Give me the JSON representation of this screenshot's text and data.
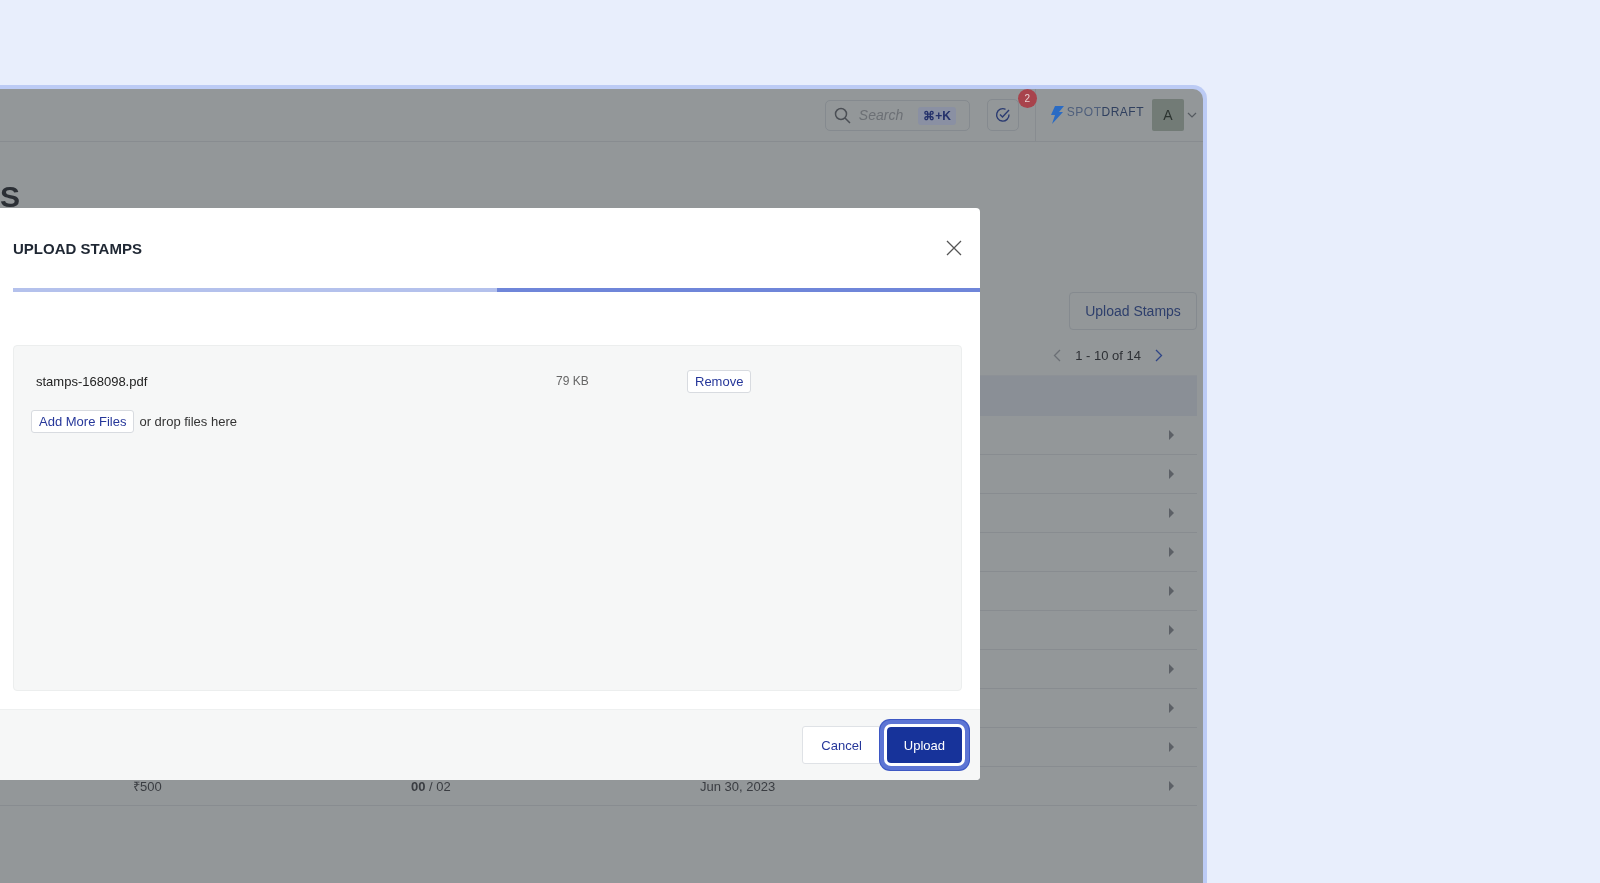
{
  "top_bar": {
    "search": {
      "placeholder": "Search",
      "shortcut": "⌘+K"
    },
    "tasks_badge": "2",
    "logo": "SPOT**DRAFT**",
    "avatar": "A"
  },
  "page": {
    "title": "S",
    "upload_button": "Upload Stamps",
    "pagination": "1 - 10 of 14",
    "rows": [
      {
        "expanded": false
      },
      {
        "expanded": false
      },
      {
        "expanded": false
      },
      {
        "expanded": false
      },
      {
        "expanded": false
      },
      {
        "expanded": false
      },
      {
        "expanded": false
      },
      {
        "expanded": false
      },
      {
        "expanded": false
      },
      {
        "expanded": false,
        "cells": [
          "₹500",
          "**00** / 02",
          "Jun 30, 2023"
        ]
      }
    ]
  },
  "modal": {
    "title": "UPLOAD STAMPS",
    "progress": {
      "level": 0.5
    },
    "files": [
      {
        "name": "stamps-168098.pdf",
        "size": "79 KB",
        "action": "Remove"
      }
    ],
    "add_button": "Add More Files",
    "drop_hint": "or drop files here",
    "buttons": [
      {
        "label": "Cancel",
        "kind": "secondary",
        "focused": false
      },
      {
        "label": "Upload",
        "kind": "primary",
        "focused": true
      }
    ]
  }
}
